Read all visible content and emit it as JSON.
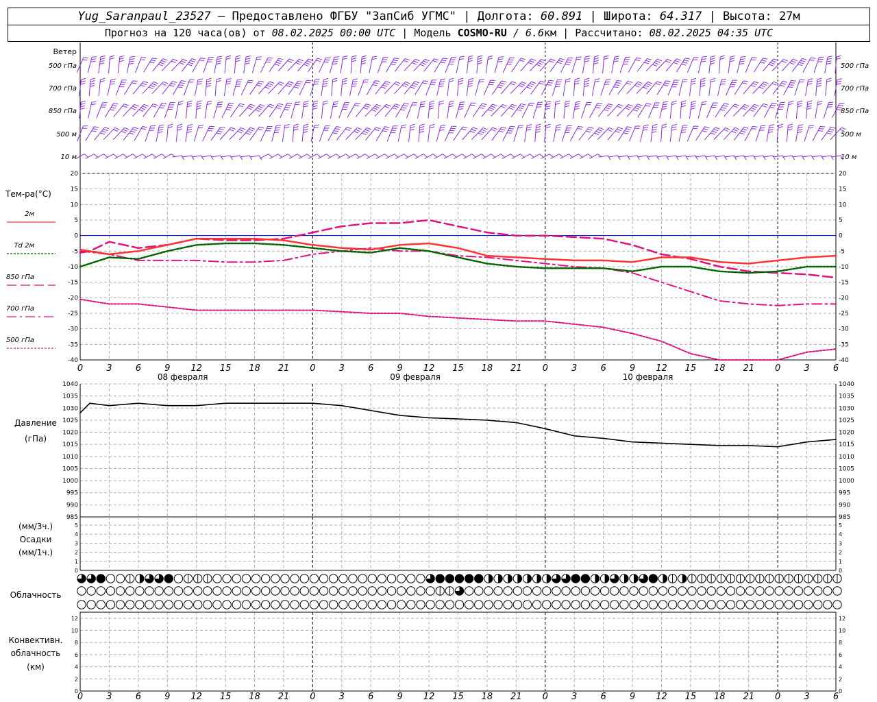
{
  "header": {
    "station": "Yug_Saranpaul_23527",
    "dash": " — ",
    "provider": "Предоставлено ФГБУ \"ЗапСиб УГМС\"",
    "sep": " | ",
    "lon_label": "Долгота: ",
    "lon_value": "60.891",
    "lat_label": "Широта: ",
    "lat_value": "64.317",
    "alt_label": "Высота: ",
    "alt_value": "27м",
    "forecast_label": "Прогноз на 120 часа(ов) от ",
    "forecast_start": "08.02.2025 00:00 UTC",
    "model_label": "Модель ",
    "model_name": "COSMO-RU",
    "model_res": " / 6.6",
    "model_res_unit": "км",
    "calc_label": "Рассчитано: ",
    "calc_time": "08.02.2025 04:35 UTC"
  },
  "chart_data": {
    "type": "line",
    "time_axis": {
      "hour_ticks": [
        "0",
        "3",
        "6",
        "9",
        "12",
        "15",
        "18",
        "21",
        "0",
        "3",
        "6",
        "9",
        "12",
        "15",
        "18",
        "21",
        "0",
        "3",
        "6",
        "9",
        "12",
        "15",
        "18",
        "21",
        "0",
        "3",
        "6"
      ],
      "date_labels": [
        "08 февраля",
        "09 февраля",
        "10 февраля"
      ]
    },
    "wind": {
      "panel_label": "Ветер",
      "levels": [
        "500 гПа",
        "700 гПа",
        "850 гПа",
        "500 м",
        "10  м"
      ],
      "colors": [
        "#8a2be2",
        "#8a2be2",
        "#8a2be2",
        "#8a2be2",
        "#8a2be2"
      ]
    },
    "temperature": {
      "ylabel": "Тем-ра(°C)",
      "ylim": [
        -40,
        20
      ],
      "ticks": [
        20,
        15,
        10,
        5,
        0,
        -5,
        -10,
        -15,
        -20,
        -25,
        -30,
        -35,
        -40
      ],
      "zero_line_color": "#0000ff",
      "series": [
        {
          "name": "2м",
          "color": "#ff3333",
          "dash": "",
          "width": 2.5,
          "hours": [
            0,
            3,
            6,
            9,
            12,
            15,
            18,
            21,
            24,
            27,
            30,
            33,
            36,
            39,
            42,
            45,
            48,
            51,
            54,
            57,
            60,
            63,
            66,
            69,
            72,
            75,
            78
          ],
          "values": [
            -4.5,
            -6,
            -5,
            -3,
            -1,
            -1,
            -1,
            -1.5,
            -3,
            -4,
            -4.5,
            -3,
            -2.5,
            -4,
            -6.5,
            -7,
            -7.5,
            -8,
            -8,
            -8.5,
            -7,
            -7,
            -8.5,
            -9,
            -8,
            -7,
            -6.5
          ]
        },
        {
          "name": "Td  2м",
          "color": "#006400",
          "dash": "3,2",
          "width": 2.5,
          "hours": [
            0,
            3,
            6,
            9,
            12,
            15,
            18,
            21,
            24,
            27,
            30,
            33,
            36,
            39,
            42,
            45,
            48,
            51,
            54,
            57,
            60,
            63,
            66,
            69,
            72,
            75,
            78
          ],
          "values": [
            -10,
            -7,
            -7.5,
            -5,
            -3,
            -2.5,
            -2.5,
            -3,
            -4,
            -5,
            -5.5,
            -4,
            -5,
            -7,
            -9,
            -10,
            -10.5,
            -10.5,
            -10.5,
            -11.5,
            -10,
            -10,
            -11.5,
            -12,
            -11.5,
            -10,
            -10
          ]
        },
        {
          "name": "850 гПа",
          "color": "#e0107e",
          "dash": "14,6",
          "width": 2.5,
          "hours": [
            0,
            1,
            3,
            6,
            9,
            12,
            15,
            18,
            21,
            24,
            27,
            30,
            33,
            36,
            39,
            42,
            45,
            48,
            51,
            54,
            57,
            60,
            63,
            66,
            69,
            72,
            75,
            78
          ],
          "values": [
            -5.5,
            -5,
            -2,
            -4,
            -3,
            -1,
            -1.5,
            -1.5,
            -1,
            1,
            3,
            4,
            4,
            5,
            3,
            1,
            0,
            0,
            -0.5,
            -1,
            -3,
            -6,
            -7.5,
            -10,
            -11.5,
            -12,
            -12.5,
            -13.5
          ]
        },
        {
          "name": "700 гПа",
          "color": "#e0107e",
          "dash": "14,5,3,5",
          "width": 2,
          "hours": [
            0,
            3,
            6,
            9,
            12,
            15,
            18,
            21,
            24,
            27,
            30,
            33,
            36,
            39,
            42,
            45,
            48,
            51,
            54,
            57,
            60,
            63,
            66,
            69,
            72,
            75,
            78
          ],
          "values": [
            -5,
            -6,
            -8,
            -8,
            -8,
            -8.5,
            -8.5,
            -8,
            -6,
            -5,
            -4,
            -5,
            -5,
            -6.5,
            -7,
            -8,
            -9,
            -10,
            -10.5,
            -12,
            -15,
            -18,
            -21,
            -22,
            -22.5,
            -22,
            -22
          ]
        },
        {
          "name": "500 гПа",
          "color": "#e0107e",
          "dash": "3,2",
          "width": 2,
          "hours": [
            0,
            3,
            6,
            9,
            12,
            15,
            18,
            21,
            24,
            27,
            30,
            33,
            36,
            39,
            42,
            45,
            48,
            51,
            54,
            57,
            60,
            63,
            66,
            69,
            72,
            75,
            78
          ],
          "values": [
            -20.5,
            -22,
            -22,
            -23,
            -24,
            -24,
            -24,
            -24,
            -24,
            -24.5,
            -25,
            -25,
            -26,
            -26.5,
            -27,
            -27.5,
            -27.5,
            -28.5,
            -29.5,
            -31.5,
            -34,
            -38,
            -40,
            -40,
            -40,
            -37.5,
            -36.5
          ]
        }
      ]
    },
    "pressure": {
      "ylabel": [
        "Давление",
        "(гПа)"
      ],
      "ylim": [
        985,
        1040
      ],
      "ticks": [
        1040,
        1035,
        1030,
        1025,
        1020,
        1015,
        1010,
        1005,
        1000,
        995,
        990,
        985
      ],
      "series": [
        {
          "name": "",
          "color": "#000000",
          "hours": [
            0,
            1,
            3,
            6,
            9,
            12,
            15,
            18,
            21,
            24,
            27,
            30,
            33,
            36,
            39,
            42,
            45,
            48,
            51,
            54,
            57,
            60,
            63,
            66,
            69,
            72,
            75,
            78
          ],
          "values": [
            1028,
            1032,
            1031,
            1032,
            1031,
            1031,
            1032,
            1032,
            1032,
            1032,
            1031,
            1029,
            1027,
            1026,
            1025.5,
            1025,
            1024,
            1021.5,
            1018.5,
            1017.5,
            1016,
            1015.5,
            1015,
            1014.5,
            1014.5,
            1014,
            1016,
            1017
          ]
        }
      ]
    },
    "precipitation": {
      "ylabel": [
        "(мм/3ч.)",
        "Осадки",
        "(мм/1ч.)"
      ],
      "ylim": [
        0,
        5
      ],
      "ticks": [
        5,
        4,
        3,
        2,
        1,
        0
      ],
      "values": []
    },
    "cloud": {
      "label": "Облачность",
      "rows": [
        "3340012334011100000000000000000000003444442222222334422322342121111111111111111111113",
        "0000000000000000000000000000000000000113000000000000000000000000000000000000000000002",
        "0000000000000000000000000000000000000000000000000000000000000000000000000000000000000"
      ]
    },
    "convective": {
      "ylabel": [
        "Конвективн.",
        "облачность",
        "(км)"
      ],
      "ylim": [
        0,
        13
      ],
      "ticks": [
        12,
        10,
        8,
        6,
        4,
        2,
        0
      ],
      "values": []
    }
  }
}
